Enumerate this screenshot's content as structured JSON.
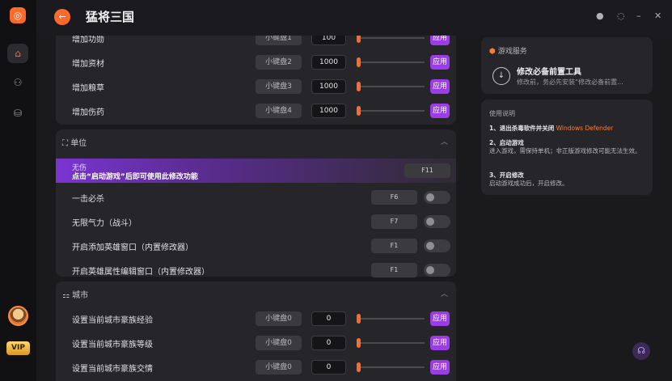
{
  "app": {
    "title": "猛将三国"
  },
  "rail": {
    "logo": "◎",
    "home_icon": "⌂",
    "game_icon": "⚇",
    "store_icon": "⛁",
    "vip_label": "VIP"
  },
  "topbar": {
    "back_icon": "←",
    "ctl1": "●",
    "ctl2": "◌",
    "ctl3": "–",
    "ctl4": "✕"
  },
  "resources": {
    "rows": [
      {
        "label": "增加功勋",
        "key": "小键盘1",
        "value": "100"
      },
      {
        "label": "增加资材",
        "key": "小键盘2",
        "value": "1000"
      },
      {
        "label": "增加粮草",
        "key": "小键盘3",
        "value": "1000"
      },
      {
        "label": "增加伤药",
        "key": "小键盘4",
        "value": "1000"
      }
    ],
    "apply_label": "应用"
  },
  "unit": {
    "header": "单位",
    "banner_title": "无伤",
    "banner_text": "点击“启动游戏”后即可使用此修改功能",
    "banner_key": "F11",
    "rows": [
      {
        "label": "一击必杀",
        "key": "F6"
      },
      {
        "label": "无限气力（战斗）",
        "key": "F7"
      },
      {
        "label": "开启添加英雄窗口（内置修改器）",
        "key": "F1"
      },
      {
        "label": "开启英雄属性编辑窗口（内置修改器）",
        "key": "F1"
      }
    ]
  },
  "city": {
    "header": "城市",
    "rows": [
      {
        "label": "设置当前城市豪族经验",
        "key": "小键盘0",
        "value": "0"
      },
      {
        "label": "设置当前城市豪族等级",
        "key": "小键盘0",
        "value": "0"
      },
      {
        "label": "设置当前城市豪族交情",
        "key": "小键盘0",
        "value": "0"
      }
    ]
  },
  "service": {
    "header": "游戏服务",
    "title": "修改必备前置工具",
    "desc": "修改前，务必先安装“修改必备前置..."
  },
  "guide": {
    "header": "使用说明",
    "s1_title": "1、退出杀毒软件并关闭",
    "s1_highlight": "Windows Defender",
    "s2_title": "2、启动游戏",
    "s2_text": "进入游戏，需保持单机；非正版游戏修改可能无法生效。",
    "s3_title": "3、开启修改",
    "s3_text": "启动游戏成功后，开启修改。"
  },
  "colors": {
    "accent": "#ff6a2a",
    "apply": "#9b3de6"
  }
}
